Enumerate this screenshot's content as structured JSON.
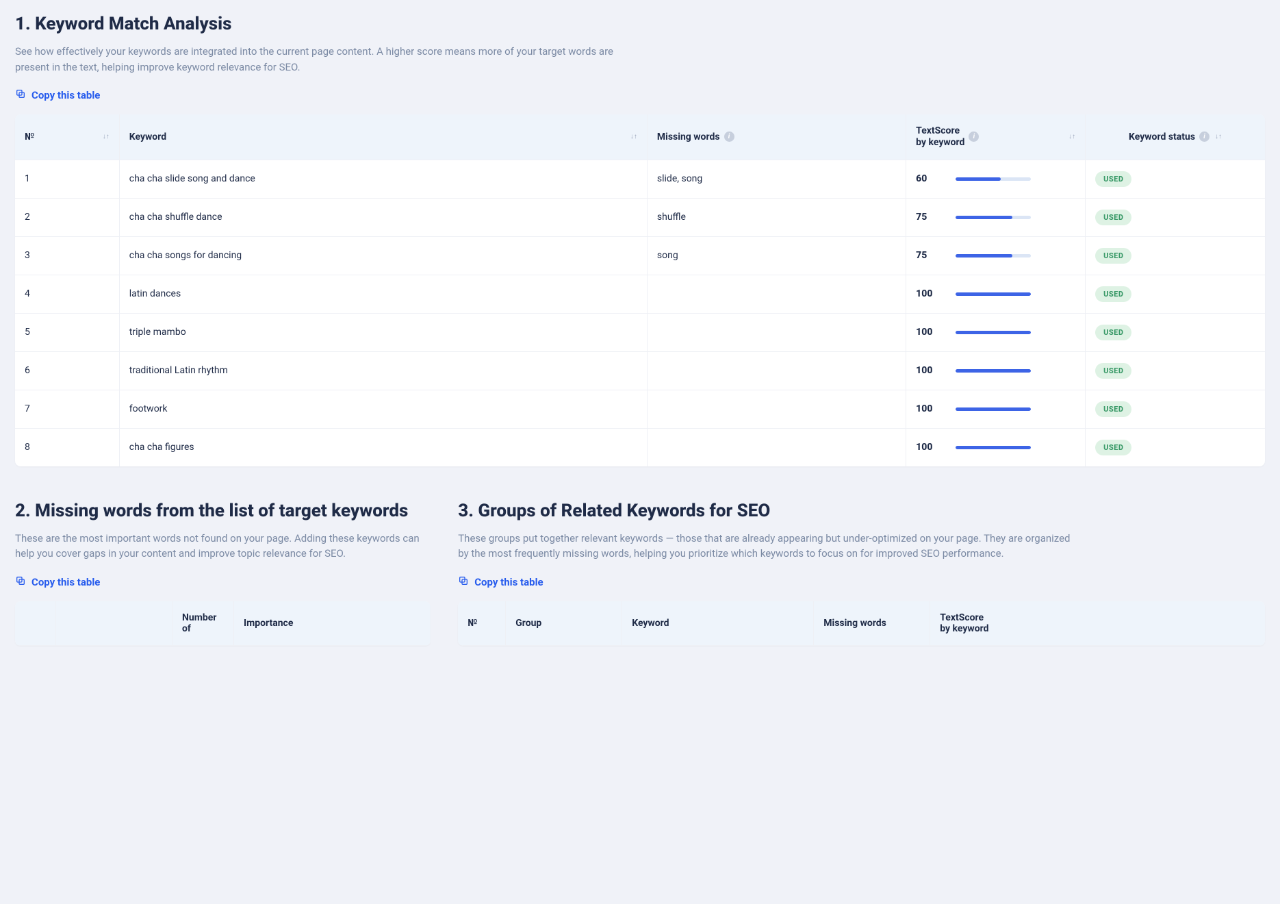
{
  "section1": {
    "title": "1. Keyword Match Analysis",
    "desc": "See how effectively your keywords are integrated into the current page content. A higher score means more of your target words are present in the text, helping improve keyword relevance for SEO.",
    "copy_label": "Copy this table",
    "headers": {
      "num": "№",
      "keyword": "Keyword",
      "missing": "Missing words",
      "score_line1": "TextScore",
      "score_line2": "by keyword",
      "status": "Keyword status"
    },
    "rows": [
      {
        "n": "1",
        "keyword": "cha cha slide song and dance",
        "missing": "slide, song",
        "score": 60,
        "status": "USED"
      },
      {
        "n": "2",
        "keyword": "cha cha shuffle dance",
        "missing": "shuffle",
        "score": 75,
        "status": "USED"
      },
      {
        "n": "3",
        "keyword": "cha cha songs for dancing",
        "missing": "song",
        "score": 75,
        "status": "USED"
      },
      {
        "n": "4",
        "keyword": "latin dances",
        "missing": "",
        "score": 100,
        "status": "USED"
      },
      {
        "n": "5",
        "keyword": "triple mambo",
        "missing": "",
        "score": 100,
        "status": "USED"
      },
      {
        "n": "6",
        "keyword": "traditional Latin rhythm",
        "missing": "",
        "score": 100,
        "status": "USED"
      },
      {
        "n": "7",
        "keyword": "footwork",
        "missing": "",
        "score": 100,
        "status": "USED"
      },
      {
        "n": "8",
        "keyword": "cha cha figures",
        "missing": "",
        "score": 100,
        "status": "USED"
      }
    ]
  },
  "section2": {
    "title": "2. Missing words from the list of target keywords",
    "desc": "These are the most important words not found on your page. Adding these keywords can help you cover gaps in your content and improve topic relevance for SEO.",
    "copy_label": "Copy this table",
    "headers": {
      "number_line1": "Number",
      "number_line2": "of",
      "importance": "Importance"
    }
  },
  "section3": {
    "title": "3. Groups of Related Keywords for SEO",
    "desc": "These groups put together relevant keywords — those that are already appearing but under-optimized on your page. They are organized by the most frequently missing words, helping you prioritize which keywords to focus on for improved SEO performance.",
    "copy_label": "Copy this table",
    "headers": {
      "num": "№",
      "group": "Group",
      "keyword": "Keyword",
      "missing": "Missing words",
      "score_line1": "TextScore",
      "score_line2": "by keyword"
    }
  }
}
